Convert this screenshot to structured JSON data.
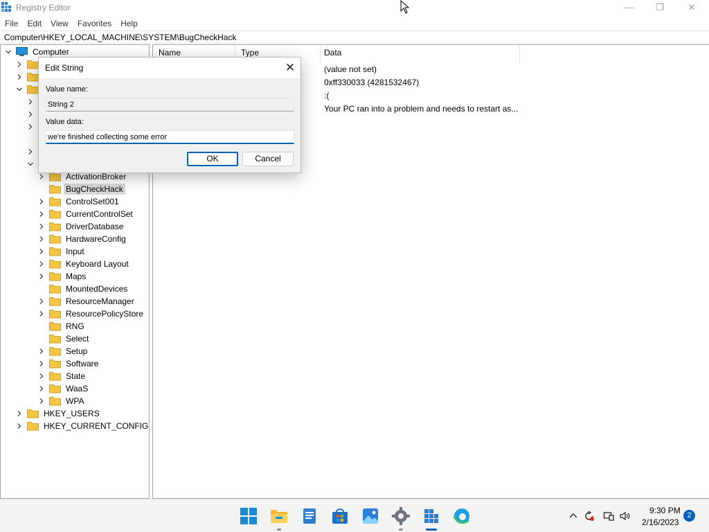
{
  "window": {
    "title": "Registry Editor",
    "controls": {
      "minimize": "—",
      "maximize": "❐",
      "close": "✕"
    }
  },
  "menu": [
    "File",
    "Edit",
    "View",
    "Favorites",
    "Help"
  ],
  "address": "Computer\\HKEY_LOCAL_MACHINE\\SYSTEM\\BugCheckHack",
  "tree": {
    "root": "Computer",
    "system_children": [
      {
        "label": "ActivationBroker",
        "expandable": true,
        "selected": false
      },
      {
        "label": "BugCheckHack",
        "expandable": false,
        "selected": true
      },
      {
        "label": "ControlSet001",
        "expandable": true,
        "selected": false
      },
      {
        "label": "CurrentControlSet",
        "expandable": true,
        "selected": false
      },
      {
        "label": "DriverDatabase",
        "expandable": true,
        "selected": false
      },
      {
        "label": "HardwareConfig",
        "expandable": true,
        "selected": false
      },
      {
        "label": "Input",
        "expandable": true,
        "selected": false
      },
      {
        "label": "Keyboard Layout",
        "expandable": true,
        "selected": false
      },
      {
        "label": "Maps",
        "expandable": true,
        "selected": false
      },
      {
        "label": "MountedDevices",
        "expandable": false,
        "selected": false
      },
      {
        "label": "ResourceManager",
        "expandable": true,
        "selected": false
      },
      {
        "label": "ResourcePolicyStore",
        "expandable": true,
        "selected": false
      },
      {
        "label": "RNG",
        "expandable": false,
        "selected": false
      },
      {
        "label": "Select",
        "expandable": false,
        "selected": false
      },
      {
        "label": "Setup",
        "expandable": true,
        "selected": false
      },
      {
        "label": "Software",
        "expandable": true,
        "selected": false
      },
      {
        "label": "State",
        "expandable": true,
        "selected": false
      },
      {
        "label": "WaaS",
        "expandable": true,
        "selected": false
      },
      {
        "label": "WPA",
        "expandable": true,
        "selected": false
      }
    ],
    "hives_after": [
      "HKEY_USERS",
      "HKEY_CURRENT_CONFIG"
    ]
  },
  "list": {
    "headers": {
      "name": "Name",
      "type": "Type",
      "data": "Data"
    },
    "data_values": [
      "(value not set)",
      "0xff330033 (4281532467)",
      ":(",
      "Your PC  ran into a problem and needs to restart as..."
    ]
  },
  "dialog": {
    "title": "Edit String",
    "close": "✕",
    "value_name_label": "Value name:",
    "value_name": "String 2",
    "value_data_label": "Value data:",
    "value_data": "we're finished collecting some error",
    "ok": "OK",
    "cancel": "Cancel"
  },
  "taskbar": {
    "time": "9:30 PM",
    "date": "2/16/2023",
    "notifications": "2",
    "apps": [
      "start-icon",
      "file-explorer-icon",
      "notepad-icon",
      "store-icon",
      "photos-icon",
      "settings-icon",
      "registry-editor-icon",
      "edge-icon"
    ],
    "tray": [
      "chevron-up-icon",
      "sync-icon",
      "network-icon",
      "volume-icon"
    ],
    "accent_color": "#005fb8"
  }
}
